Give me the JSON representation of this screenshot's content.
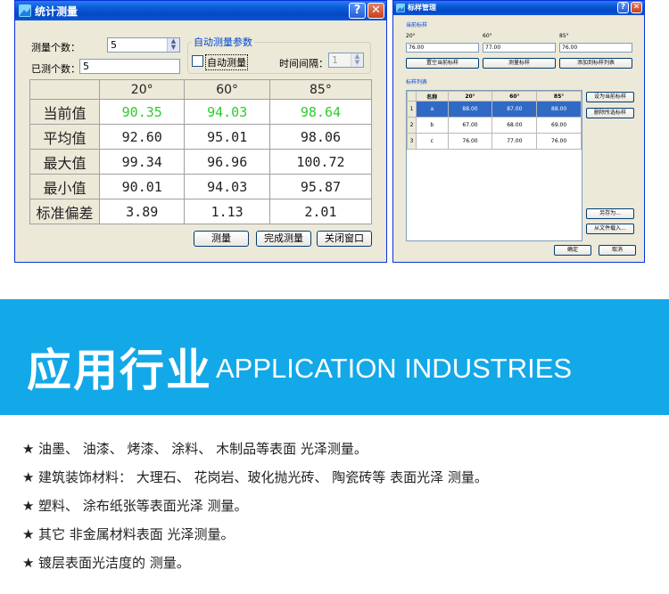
{
  "win1": {
    "title": "统计测量",
    "help_glyph": "?",
    "close_glyph": "✕",
    "count_label": "测量个数：",
    "count_value": "5",
    "measured_label": "已测个数：",
    "measured_value": "5",
    "group_title": "自动测量参数",
    "auto_label": "自动测量",
    "interval_label": "时间间隔：",
    "interval_value": "1",
    "columns": [
      "20°",
      "60°",
      "85°"
    ],
    "rows": [
      {
        "label": "当前值",
        "values": [
          "90.35",
          "94.03",
          "98.64"
        ]
      },
      {
        "label": "平均值",
        "values": [
          "92.60",
          "95.01",
          "98.06"
        ]
      },
      {
        "label": "最大值",
        "values": [
          "99.34",
          "96.96",
          "100.72"
        ]
      },
      {
        "label": "最小值",
        "values": [
          "90.01",
          "94.03",
          "95.87"
        ]
      },
      {
        "label": "标准偏差",
        "values": [
          "3.89",
          "1.13",
          "2.01"
        ]
      }
    ],
    "btn_measure": "测量",
    "btn_finish": "完成测量",
    "btn_close": "关闭窗口",
    "current_value_color": "#2ecc2e"
  },
  "win2": {
    "title": "标样管理",
    "help_glyph": "?",
    "close_glyph": "✕",
    "current_section": "当前标样",
    "angles": [
      "20°",
      "60°",
      "85°"
    ],
    "inputs": [
      "76.00",
      "77.00",
      "76.00"
    ],
    "btn_clear": "置空当前标样",
    "btn_measure": "测量标样",
    "btn_add": "添加到标样列表",
    "list_section": "标样列表",
    "list_headers": [
      "名称",
      "20°",
      "60°",
      "85°"
    ],
    "list_rows": [
      {
        "num": "1",
        "name": "a",
        "v": [
          "88.00",
          "87.00",
          "88.00"
        ]
      },
      {
        "num": "2",
        "name": "b",
        "v": [
          "67.00",
          "68.00",
          "69.00"
        ]
      },
      {
        "num": "3",
        "name": "c",
        "v": [
          "76.00",
          "77.00",
          "76.00"
        ]
      }
    ],
    "btn_set_current": "设为当前标样",
    "btn_delete": "删除所选标样",
    "btn_save_as": "另存为...",
    "btn_load": "从文件载入...",
    "btn_ok": "确定",
    "btn_cancel": "取消",
    "selected_color": "#316ac5"
  },
  "banner": {
    "title_cn": "应用行业",
    "title_en": "APPLICATION INDUSTRIES",
    "bg_color": "#13a8e8"
  },
  "industries": [
    "油墨、 油漆、 烤漆、 涂料、 木制品等表面 光泽测量。",
    "建筑装饰材料： 大理石、 花岗岩、玻化抛光砖、 陶瓷砖等 表面光泽 测量。",
    "塑料、 涂布纸张等表面光泽 测量。",
    "其它 非金属材料表面 光泽测量。",
    "镀层表面光洁度的 测量。"
  ],
  "bullet": "★"
}
